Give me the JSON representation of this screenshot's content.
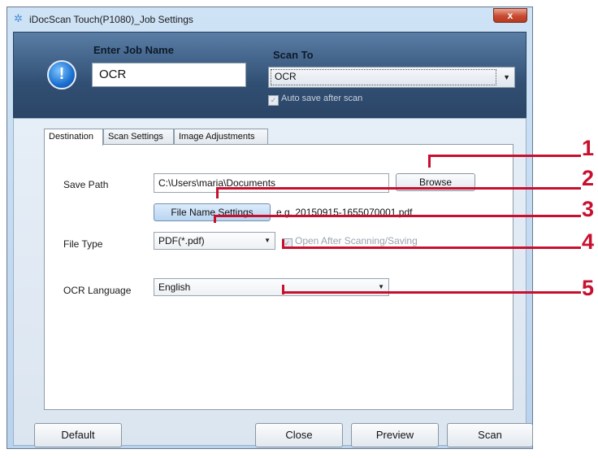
{
  "window": {
    "title": "iDocScan Touch(P1080)_Job Settings",
    "close_label": "x"
  },
  "header": {
    "job_name_label": "Enter Job Name",
    "job_name_value": "OCR",
    "scan_to_label": "Scan To",
    "scan_to_value": "OCR",
    "auto_save_label": "Auto save after scan",
    "auto_save_checked": true
  },
  "tabs": [
    {
      "label": "Destination",
      "active": true
    },
    {
      "label": "Scan Settings",
      "active": false
    },
    {
      "label": "Image Adjustments",
      "active": false
    }
  ],
  "destination": {
    "save_path_label": "Save Path",
    "save_path_value": "C:\\Users\\maria\\Documents",
    "browse_label": "Browse",
    "file_name_settings_label": "File Name Settings",
    "file_name_example": "e.g. 20150915-1655070001.pdf",
    "file_type_label": "File Type",
    "file_type_value": "PDF(*.pdf)",
    "open_after_label": "Open After Scanning/Saving",
    "open_after_checked": true,
    "ocr_language_label": "OCR Language",
    "ocr_language_value": "English"
  },
  "footer": {
    "default_label": "Default",
    "close_label": "Close",
    "preview_label": "Preview",
    "scan_label": "Scan"
  },
  "callouts": [
    "1",
    "2",
    "3",
    "4",
    "5"
  ],
  "colors": {
    "callout": "#c8102e",
    "header_bg": "#314f73",
    "window_bg": "#cfe3f6"
  }
}
